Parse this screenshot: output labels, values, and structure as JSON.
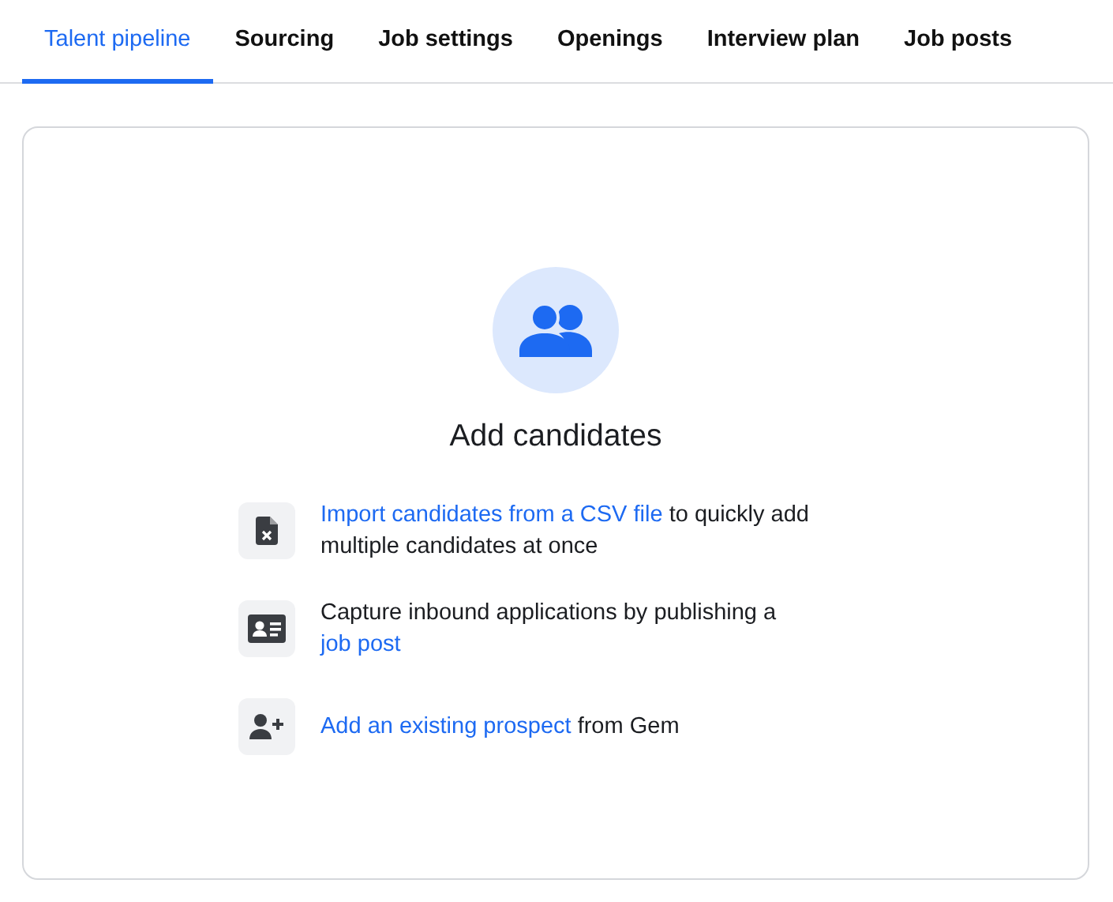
{
  "tabs": [
    {
      "label": "Talent pipeline",
      "selected": true
    },
    {
      "label": "Sourcing",
      "selected": false
    },
    {
      "label": "Job settings",
      "selected": false
    },
    {
      "label": "Openings",
      "selected": false
    },
    {
      "label": "Interview plan",
      "selected": false
    },
    {
      "label": "Job posts",
      "selected": false
    }
  ],
  "empty_state": {
    "title": "Add candidates",
    "options": [
      {
        "parts": [
          {
            "text": "Import candidates from a CSV file",
            "link": true
          },
          {
            "text": " to quickly add multiple candidates at once",
            "link": false
          }
        ]
      },
      {
        "parts": [
          {
            "text": "Capture inbound applications by publishing a ",
            "link": false
          },
          {
            "text": "job post",
            "link": true
          }
        ]
      },
      {
        "parts": [
          {
            "text": "Add an existing prospect",
            "link": true
          },
          {
            "text": " from Gem",
            "link": false
          }
        ]
      }
    ]
  }
}
